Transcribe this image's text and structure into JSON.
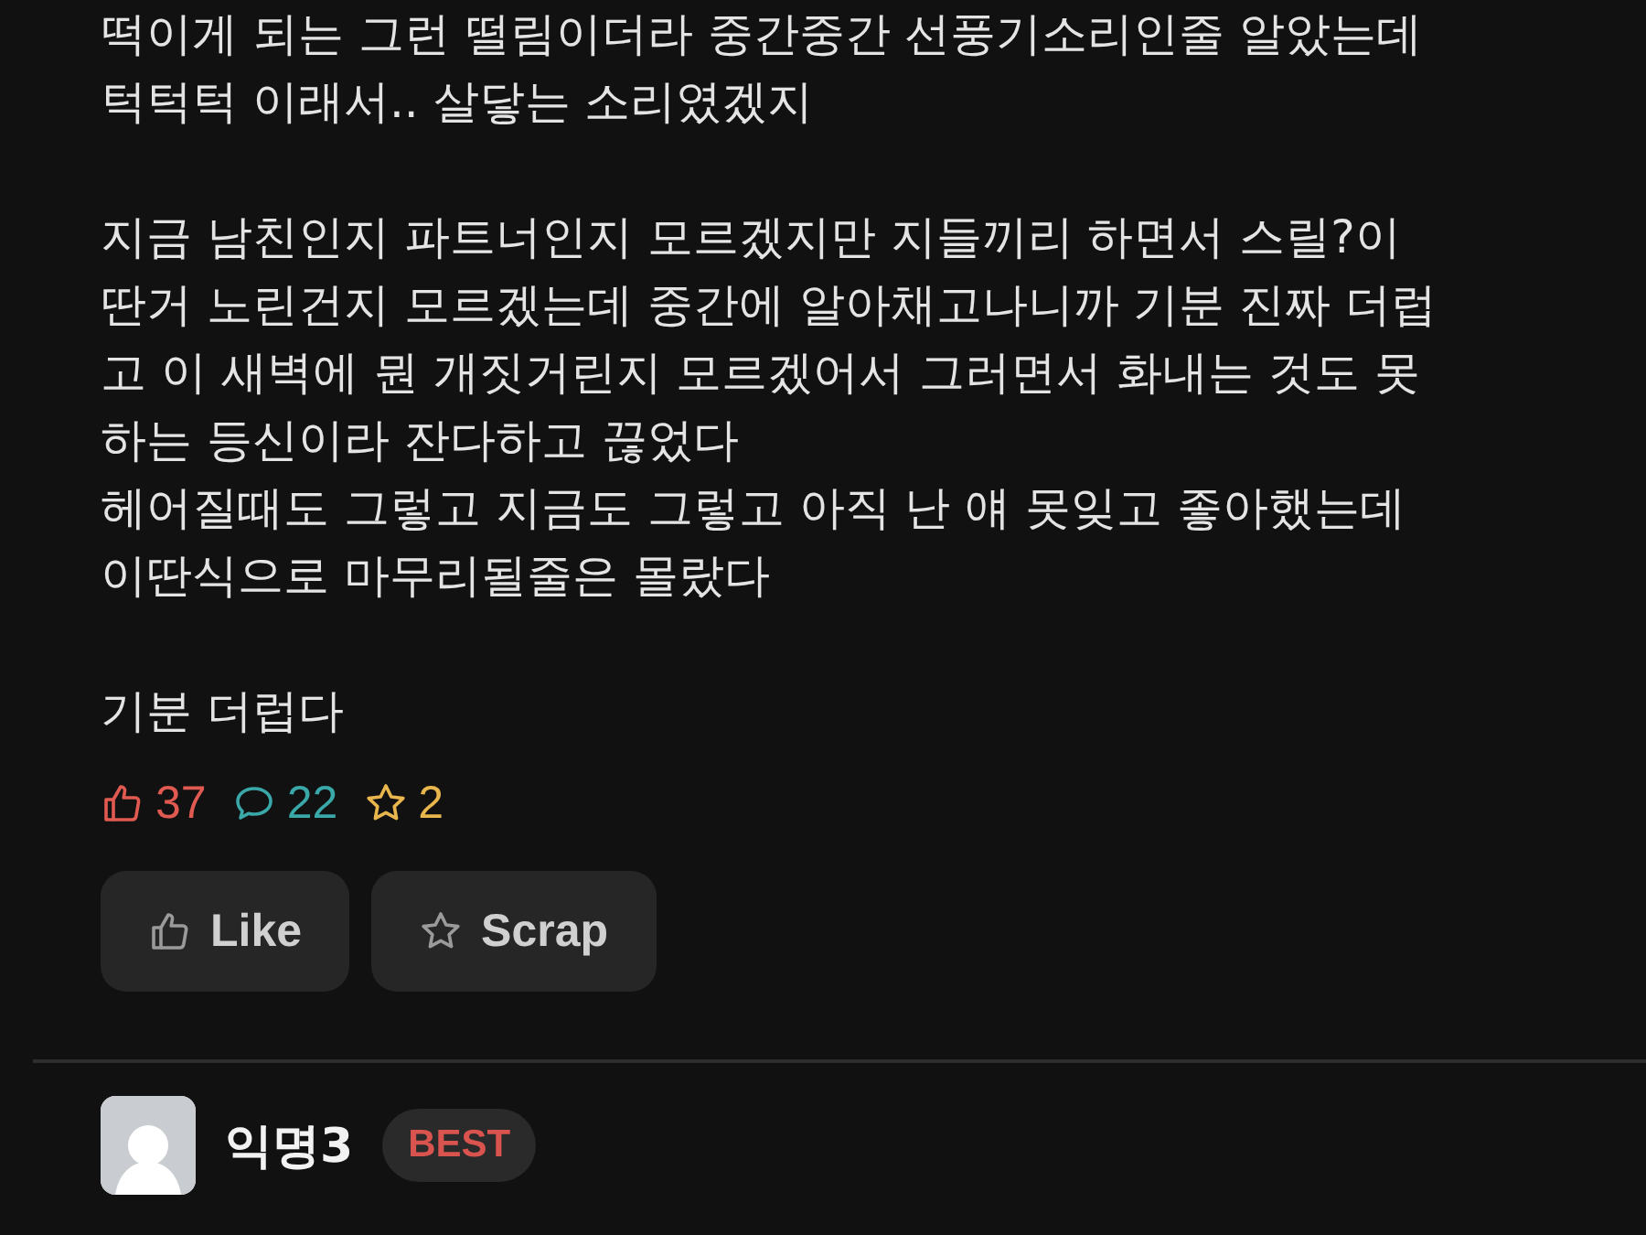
{
  "post": {
    "paragraphs": [
      [
        "떡이게 되는 그런 떨림이더라 중간중간 선풍기소리인줄 알았는데",
        "턱턱턱 이래서.. 살닿는 소리였겠지"
      ],
      [
        "지금 남친인지 파트너인지 모르겠지만 지들끼리 하면서 스릴?이",
        "딴거 노린건지 모르겠는데 중간에 알아채고나니까 기분 진짜 더럽",
        "고 이 새벽에 뭔 개짓거린지 모르겠어서 그러면서 화내는 것도 못",
        "하는 등신이라 잔다하고 끊었다",
        "헤어질때도 그렇고 지금도 그렇고 아직 난 얘 못잊고 좋아했는데",
        "이딴식으로 마무리될줄은 몰랐다"
      ],
      [
        "기분 더럽다"
      ]
    ],
    "stats": [
      {
        "kind": "likes",
        "count": "37",
        "color": "#e05a52"
      },
      {
        "kind": "comments",
        "count": "22",
        "color": "#3aa7a9"
      },
      {
        "kind": "scraps",
        "count": "2",
        "color": "#e8b64c"
      }
    ],
    "buttons": [
      {
        "kind": "like",
        "label": "Like"
      },
      {
        "kind": "scrap",
        "label": "Scrap"
      }
    ]
  },
  "comment": {
    "author": "익명3",
    "badge": "BEST"
  }
}
